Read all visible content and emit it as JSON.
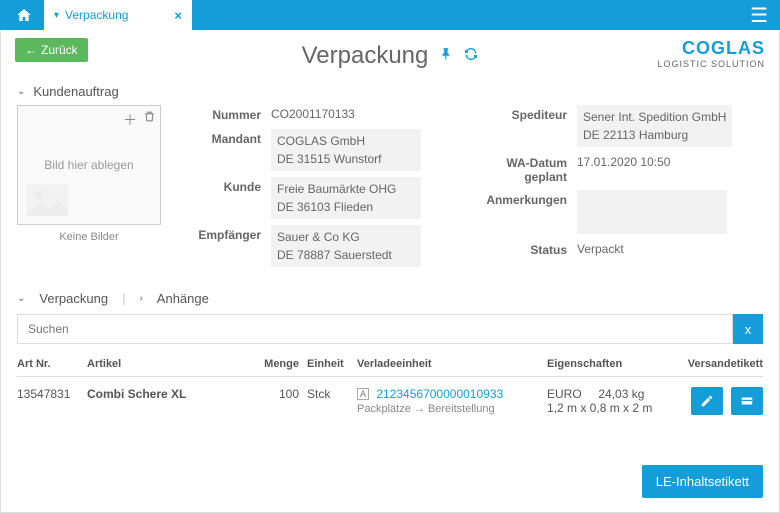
{
  "topbar": {
    "tab_label": "Verpackung",
    "tab_close": "×"
  },
  "back_label": "Zurück",
  "page_title": "Verpackung",
  "brand": {
    "top": "COGLAS",
    "sub": "LOGISTIC SOLUTION"
  },
  "section": {
    "order_title": "Kundenauftrag",
    "img_drop": "Bild hier ablegen",
    "img_caption": "Keine Bilder"
  },
  "labels": {
    "nummer": "Nummer",
    "mandant": "Mandant",
    "kunde": "Kunde",
    "empfaenger": "Empfänger",
    "spediteur": "Spediteur",
    "wa_datum": "WA-Datum geplant",
    "anmerkungen": "Anmerkungen",
    "status": "Status"
  },
  "order": {
    "nummer": "CO2001170133",
    "mandant_l1": "COGLAS GmbH",
    "mandant_l2": "DE 31515 Wunstorf",
    "kunde_l1": "Freie Baumärkte OHG",
    "kunde_l2": "DE 36103 Flieden",
    "empf_l1": "Sauer & Co KG",
    "empf_l2": "DE 78887 Sauerstedt",
    "sped_l1": "Sener Int. Spedition GmbH",
    "sped_l2": "DE 22113 Hamburg",
    "wa_datum": "17.01.2020 10:50",
    "status": "Verpackt"
  },
  "tabs": {
    "verpackung": "Verpackung",
    "anhaenge": "Anhänge"
  },
  "search": {
    "placeholder": "Suchen",
    "clear": "x"
  },
  "grid": {
    "head": {
      "artnr": "Art Nr.",
      "artikel": "Artikel",
      "menge": "Menge",
      "einheit": "Einheit",
      "verlade": "Verladeeinheit",
      "eigen": "Eigenschaften",
      "versand": "Versandetikett"
    },
    "row": {
      "artnr": "13547831",
      "artikel": "Combi Schere XL",
      "menge": "100",
      "einheit": "Stck",
      "le_badge": "A",
      "le_num": "2123456700000010933",
      "le_sub": "Packplätze → Bereitstellung",
      "eigen_top": "EURO     24,03 kg",
      "eigen_dim": "1,2 m x 0,8 m x 2 m"
    }
  },
  "footer_btn": "LE-Inhaltsetikett"
}
